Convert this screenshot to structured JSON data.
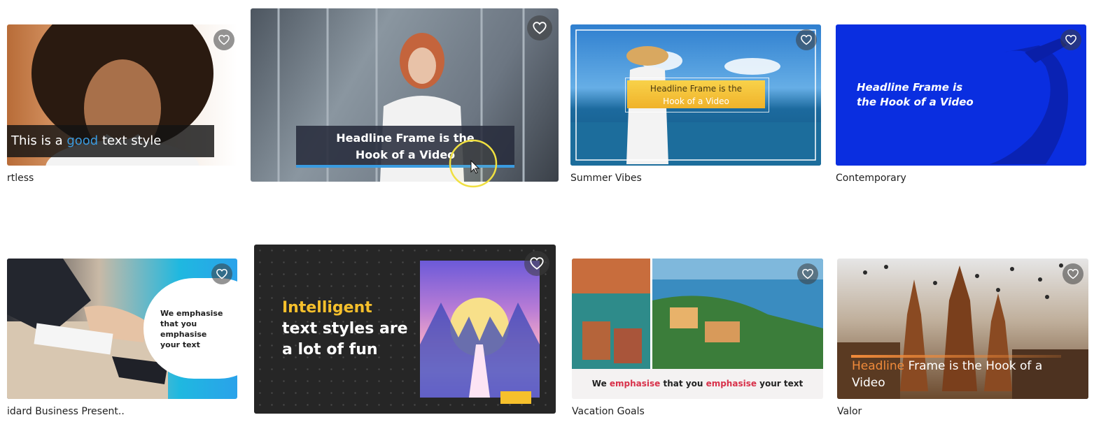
{
  "cards": [
    {
      "label": "rtless",
      "overlay": {
        "pre": "This is a ",
        "accent": "good",
        "post": " text style"
      },
      "favorite_icon": "heart-outline-icon"
    },
    {
      "label": "",
      "overlay": {
        "line1": "Headline Frame is the",
        "line2": "Hook of a Video"
      },
      "favorite_icon": "heart-outline-icon"
    },
    {
      "label": "Summer Vibes",
      "overlay": {
        "line1": "Headline Frame is the",
        "line2": "Hook of a Video"
      },
      "favorite_icon": "heart-outline-icon"
    },
    {
      "label": "Contemporary",
      "overlay": {
        "line1": "Headline Frame is",
        "line2": "the Hook of a Video"
      },
      "favorite_icon": "heart-outline-icon"
    },
    {
      "label": "idard Business Present..",
      "overlay": {
        "line1": "We emphasise",
        "line2": "that you",
        "line3": "emphasise",
        "line4": "your text"
      },
      "favorite_icon": "heart-outline-icon"
    },
    {
      "label": "",
      "overlay": {
        "accent": "Intelligent",
        "line2": "text styles are",
        "line3": "a lot of fun"
      },
      "favorite_icon": "heart-outline-icon"
    },
    {
      "label": "Vacation Goals",
      "overlay": {
        "w1": "We ",
        "a1": "emphasise",
        "w2": " that you ",
        "a2": "emphasise",
        "w3": " your text"
      },
      "favorite_icon": "heart-outline-icon"
    },
    {
      "label": "Valor",
      "overlay": {
        "accent": "Headline",
        "rest": " Frame is the Hook of a",
        "line2": "Video"
      },
      "favorite_icon": "heart-outline-icon"
    }
  ],
  "colors": {
    "accent_blue": "#3a9be0",
    "accent_yellow": "#f6c02c",
    "accent_red": "#d8314a",
    "accent_orange": "#f08a3a"
  }
}
